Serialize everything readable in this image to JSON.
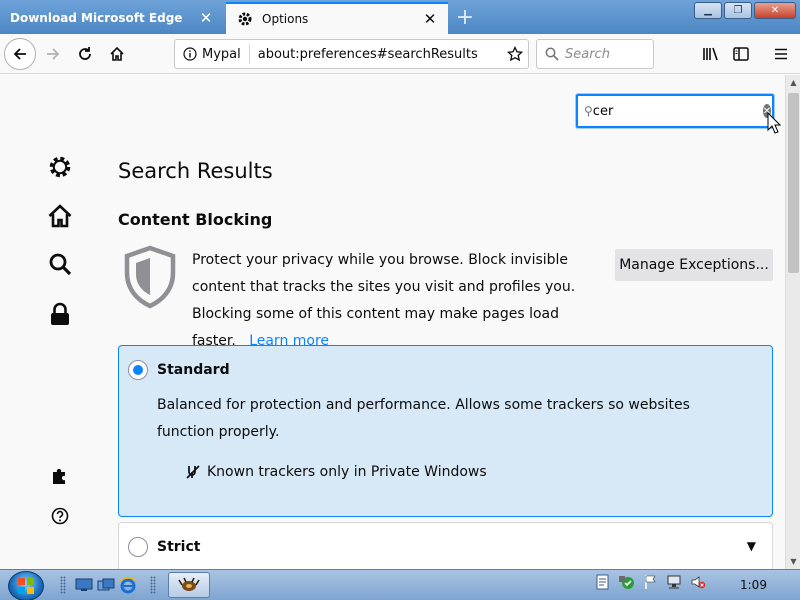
{
  "tabs": [
    {
      "title": "Download Microsoft Edge",
      "active": false
    },
    {
      "title": "Options",
      "active": true
    }
  ],
  "new_tab_icon": "plus-icon",
  "navbar": {
    "site_label": "Mypal",
    "url": "about:preferences#searchResults",
    "search_placeholder": "Search"
  },
  "prefs_search": {
    "value": "cer"
  },
  "sidebar_icons": [
    "gear-icon",
    "home-icon",
    "search-icon",
    "lock-icon",
    "puzzle-icon",
    "help-icon"
  ],
  "page": {
    "heading": "Search Results",
    "section_title": "Content Blocking",
    "description": "Protect your privacy while you browse. Block invisible content that tracks the sites you visit and profiles you. Blocking some of this content may make pages load faster.",
    "learn_more": "Learn more",
    "manage_exceptions": "Manage Exceptions..."
  },
  "options": [
    {
      "label": "Standard",
      "selected": true,
      "detail": "Balanced for protection and performance. Allows some trackers so websites function properly.",
      "tracker_note": "Known trackers only in Private Windows"
    },
    {
      "label": "Strict",
      "selected": false
    }
  ],
  "taskbar": {
    "clock": "1:09"
  },
  "colors": {
    "accent": "#0a84ff",
    "selected_card_bg": "#d7e8f7",
    "page_bg": "#f9f9fa"
  }
}
